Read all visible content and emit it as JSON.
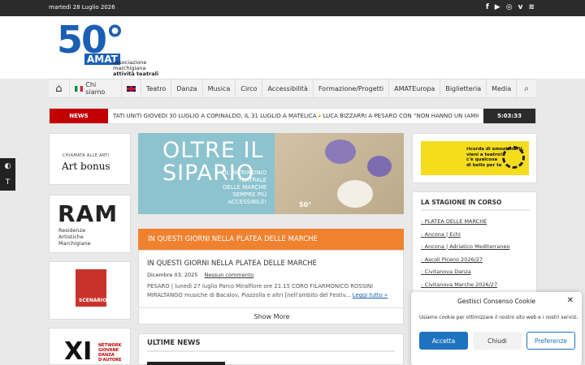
{
  "topbar": {
    "date": "martedì 28 Luglio 2026",
    "social": [
      "f",
      "▶",
      "◎",
      "v",
      "≋"
    ]
  },
  "logo": {
    "fifty": "50°",
    "amat": "AMAT",
    "line1": "associazione",
    "line2": "marchigiana",
    "line3": "attività teatrali"
  },
  "nav": {
    "home_icon": "⌂",
    "items": [
      "Chi siamo",
      "",
      "Teatro",
      "Danza",
      "Musica",
      "Circo",
      "Accessibilità",
      "Formazione/Progetti",
      "AMATEuropa",
      "Biglietteria",
      "Media"
    ],
    "search_icon": "⌕"
  },
  "ticker": {
    "label": "NEWS",
    "text1": "TATI UNITI GIOVEDÌ 30 LUGLIO A CORINALDO, IL 31 LUGLIO A MATELICA",
    "sep": "▸",
    "text2": "LUCA BIZZARRI A PESARO CON “NON HANNO UN (AMICO) DUBBIO”",
    "clock": "5:03:33"
  },
  "access": {
    "contrast_icon": "◐",
    "font_icon": "T"
  },
  "sidebar_left": {
    "c1_t1": "CHIAMATA ALLE ARTI",
    "c1_t2": "Art bonus",
    "c2_big": "RAM",
    "c2_l1": "Residenze",
    "c2_l2": "Artistiche",
    "c2_l3": "Marchigiane",
    "c3_text": "SCENARIO",
    "c4_big": "XI",
    "c4_l1": "NETWORK",
    "c4_l2": "GIOVANE",
    "c4_l3": "DANZA",
    "c4_l4": "D'AUTORE"
  },
  "banner": {
    "h1a": "OLTRE IL",
    "h1b": "SIPARIO",
    "sub1": "IL PATRIMONIO",
    "sub2": "TEATRALE",
    "sub3": "DELLE MARCHE",
    "sub4": "SEMPRE PIÙ",
    "sub5": "ACCESSIBILE!",
    "logos": "50°"
  },
  "feature": {
    "header": "IN QUESTI GIORNI NELLA PLATEA DELLE MARCHE",
    "title": "IN QUESTI GIORNI NELLA PLATEA DELLE MARCHE",
    "date": "Dicembre 03, 2025",
    "comments": "Nessun commento",
    "body": "PESARO | lunedì 27 luglio Parco Miralfiore ore 21.15 CORO FILARMONICO ROSSINI MIRALTANGO musiche di Bacalov, Piazzolla e altri [nell'ambito del Festiv...",
    "read_more": "Leggi tutto »",
    "show_more": "Show More"
  },
  "news": {
    "header": "ULTIME NEWS"
  },
  "ad": {
    "l1": "ricorda di emozionarti,",
    "l2": "vieni a teatro!",
    "l3": "c'è qualcosa",
    "l4": "di bello per te"
  },
  "stagione": {
    "header": "LA STAGIONE IN CORSO",
    "items": [
      "PLATEA DELLE MARCHE",
      "Ancona | Echi",
      "Ancona | Adriatico Mediterraneo",
      "Ascoli Piceno 2026/27",
      "Civitanova Danza",
      "Civitanova Marche 2026/27"
    ]
  },
  "cookie": {
    "title": "Gestisci Consenso Cookie",
    "close": "✕",
    "message": "Usiamo cookie per ottimizzare il nostro sito web e i nostri servizi.",
    "accept": "Accetta",
    "close_btn": "Chiudi",
    "prefs": "Preferenze"
  }
}
